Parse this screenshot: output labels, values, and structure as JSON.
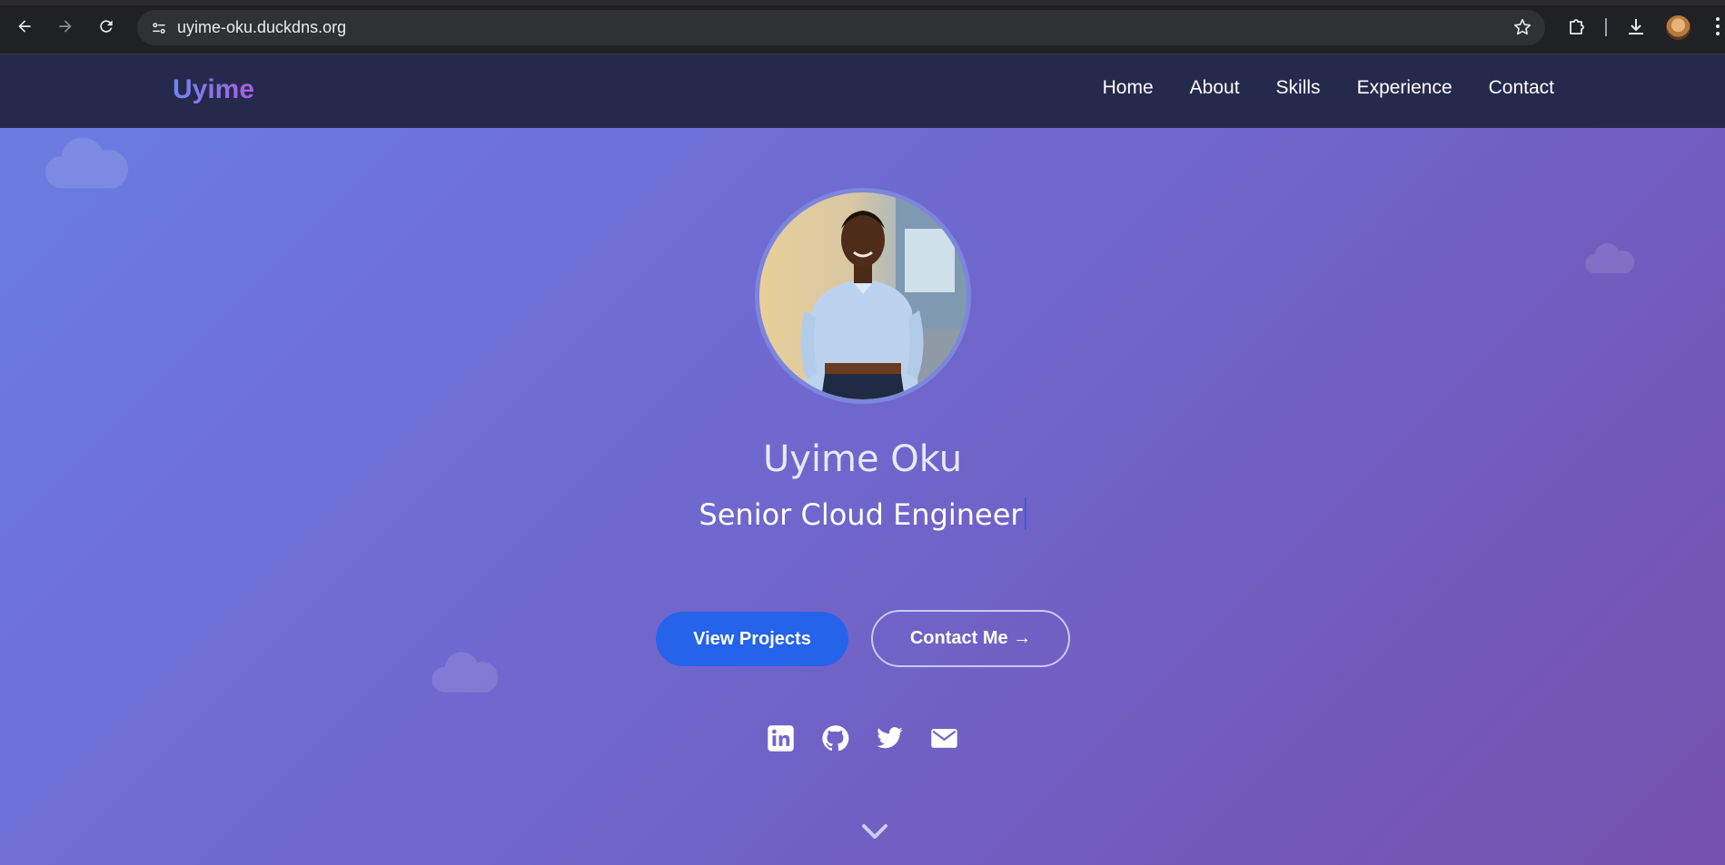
{
  "browser": {
    "url": "uyime-oku.duckdns.org",
    "icons": [
      "back-icon",
      "forward-icon",
      "reload-icon",
      "site-info-icon",
      "bookmark-star-icon",
      "extensions-icon",
      "download-icon",
      "profile-avatar",
      "menu-kebab-icon"
    ]
  },
  "navbar": {
    "brand": "Uyime",
    "links": [
      {
        "label": "Home"
      },
      {
        "label": "About"
      },
      {
        "label": "Skills"
      },
      {
        "label": "Experience"
      },
      {
        "label": "Contact"
      }
    ]
  },
  "hero": {
    "name": "Uyime Oku",
    "title": "Senior Cloud Engineer",
    "primary_button": "View Projects",
    "secondary_button": "Contact Me →",
    "socials": [
      "linkedin-icon",
      "github-icon",
      "twitter-icon",
      "email-icon"
    ],
    "scroll_icon": "chevron-down-icon"
  },
  "colors": {
    "navbar_bg": "#252a4d",
    "gradient_start": "#6a7ee3",
    "gradient_end": "#7551ad",
    "primary_button": "#2563eb",
    "brand_gradient": [
      "#6f86f2",
      "#a65de2"
    ]
  }
}
